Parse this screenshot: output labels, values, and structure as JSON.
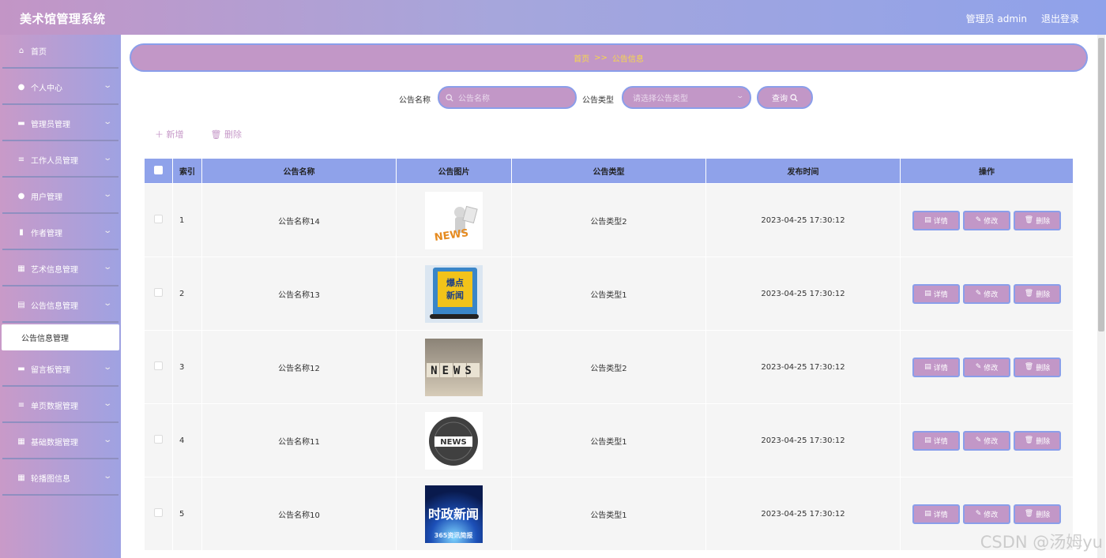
{
  "header": {
    "title": "美术馆管理系统",
    "user_label": "管理员 admin",
    "logout_label": "退出登录"
  },
  "sidebar": {
    "items": [
      {
        "label": "首页",
        "icon": "home-icon",
        "glyph": "⌂",
        "arrow": false
      },
      {
        "label": "个人中心",
        "icon": "user-icon",
        "glyph": "●",
        "arrow": true
      },
      {
        "label": "管理员管理",
        "icon": "monitor-icon",
        "glyph": "▬",
        "arrow": true
      },
      {
        "label": "工作人员管理",
        "icon": "list-icon",
        "glyph": "≡",
        "arrow": true
      },
      {
        "label": "用户管理",
        "icon": "location-icon",
        "glyph": "●",
        "arrow": true
      },
      {
        "label": "作者管理",
        "icon": "bar-chart-icon",
        "glyph": "▮",
        "arrow": true
      },
      {
        "label": "艺术信息管理",
        "icon": "grid-icon",
        "glyph": "▦",
        "arrow": true
      },
      {
        "label": "公告信息管理",
        "icon": "document-icon",
        "glyph": "▤",
        "arrow": true
      }
    ],
    "submenu": {
      "label": "公告信息管理"
    },
    "items_after": [
      {
        "label": "留言板管理",
        "icon": "chat-icon",
        "glyph": "▬",
        "arrow": true
      },
      {
        "label": "单页数据管理",
        "icon": "sliders-icon",
        "glyph": "≡",
        "arrow": true
      },
      {
        "label": "基础数据管理",
        "icon": "grid-icon",
        "glyph": "▦",
        "arrow": true
      },
      {
        "label": "轮播图信息",
        "icon": "grid-icon",
        "glyph": "▦",
        "arrow": true
      }
    ]
  },
  "breadcrumb": {
    "home": "首页",
    "sep": ">>",
    "current": "公告信息"
  },
  "search": {
    "name_label": "公告名称",
    "name_placeholder": "公告名称",
    "type_label": "公告类型",
    "type_placeholder": "请选择公告类型",
    "query_label": "查询"
  },
  "actions": {
    "add_label": "新增",
    "delete_label": "删除"
  },
  "table": {
    "columns": [
      "索引",
      "公告名称",
      "公告图片",
      "公告类型",
      "发布时间",
      "操作"
    ],
    "rows": [
      {
        "index": "1",
        "name": "公告名称14",
        "image": "news-3d-figure-image",
        "type": "公告类型2",
        "time": "2023-04-25 17:30:12"
      },
      {
        "index": "2",
        "name": "公告名称13",
        "image": "breaking-news-phone-image",
        "type": "公告类型1",
        "time": "2023-04-25 17:30:12"
      },
      {
        "index": "3",
        "name": "公告名称12",
        "image": "news-cubes-image",
        "type": "公告类型2",
        "time": "2023-04-25 17:30:12"
      },
      {
        "index": "4",
        "name": "公告名称11",
        "image": "news-globe-badge-image",
        "type": "公告类型1",
        "time": "2023-04-25 17:30:12"
      },
      {
        "index": "5",
        "name": "公告名称10",
        "image": "politics-news-banner-image",
        "type": "公告类型1",
        "time": "2023-04-25 17:30:12"
      }
    ],
    "op_labels": {
      "detail": "详情",
      "edit": "修改",
      "delete": "删除"
    },
    "image_texts": {
      "r1": "NEWS",
      "r2": [
        "爆点",
        "新闻"
      ],
      "r3": "NEWS",
      "r4": "NEWS",
      "r5": [
        "时政新闻",
        "365资讯简报"
      ]
    }
  },
  "watermark": "CSDN @汤姆yu",
  "colors": {
    "accent": "#c297c7",
    "accent_border": "#8a9eea",
    "header_blue": "#8fa2ea",
    "breadcrumb_text": "#f7d84a"
  }
}
